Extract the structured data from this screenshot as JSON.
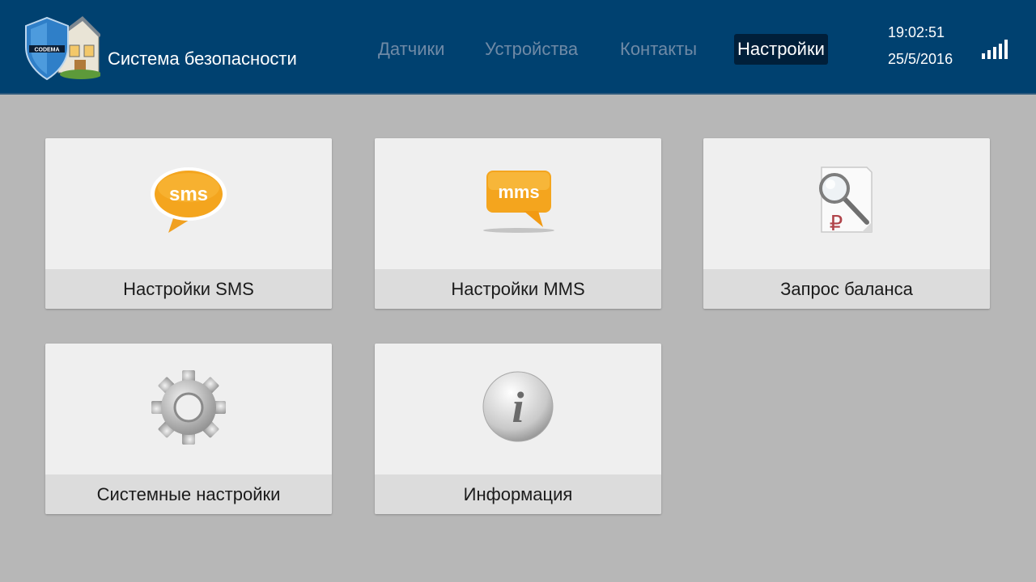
{
  "header": {
    "app_title": "Система безопасности",
    "logo_icon": "house-shield-logo",
    "background_color": "#004170",
    "tabs": [
      {
        "label": "Датчики",
        "active": false
      },
      {
        "label": "Устройства",
        "active": false
      },
      {
        "label": "Контакты",
        "active": false
      },
      {
        "label": "Настройки",
        "active": true
      }
    ],
    "time": "19:02:51",
    "date": "25/5/2016",
    "signal_icon": "signal-strength-icon",
    "signal_bars": 5
  },
  "main": {
    "background_color": "#b7b7b7",
    "tiles": [
      {
        "label": "Настройки SMS",
        "icon": "sms-bubble-icon",
        "icon_text": "sms"
      },
      {
        "label": "Настройки MMS",
        "icon": "mms-bubble-icon",
        "icon_text": "mms"
      },
      {
        "label": "Запрос баланса",
        "icon": "balance-search-icon",
        "icon_text": "₽"
      },
      {
        "label": "Системные настройки",
        "icon": "gear-icon"
      },
      {
        "label": "Информация",
        "icon": "info-icon",
        "icon_text": "i"
      }
    ]
  }
}
